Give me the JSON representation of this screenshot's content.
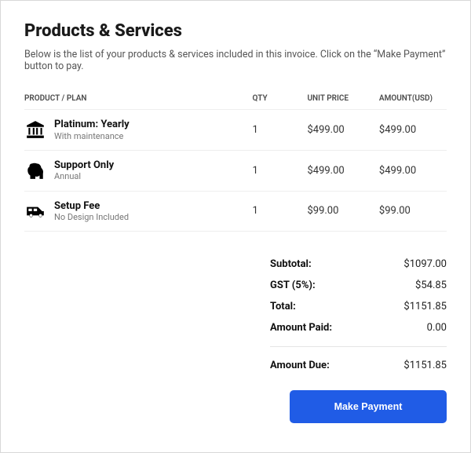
{
  "header": {
    "title": "Products & Services",
    "subtitle": "Below is the list of your products & services included in this invoice. Click on the “Make Payment” button to pay."
  },
  "table": {
    "columns": {
      "product": "PRODUCT / PLAN",
      "qty": "QTY",
      "unit_price": "UNIT PRICE",
      "amount": "AMOUNT(USD)"
    },
    "rows": [
      {
        "icon": "bank-icon",
        "name": "Platinum: Yearly",
        "desc": "With maintenance",
        "qty": "1",
        "unit_price": "$499.00",
        "amount": "$499.00"
      },
      {
        "icon": "gorilla-icon",
        "name": "Support Only",
        "desc": "Annual",
        "qty": "1",
        "unit_price": "$499.00",
        "amount": "$499.00"
      },
      {
        "icon": "van-icon",
        "name": "Setup Fee",
        "desc": "No Design Included",
        "qty": "1",
        "unit_price": "$99.00",
        "amount": "$99.00"
      }
    ]
  },
  "totals": {
    "subtotal_label": "Subtotal:",
    "subtotal_value": "$1097.00",
    "gst_label": "GST (5%):",
    "gst_value": "$54.85",
    "total_label": "Total:",
    "total_value": "$1151.85",
    "paid_label": "Amount Paid:",
    "paid_value": "0.00",
    "due_label": "Amount Due:",
    "due_value": "$1151.85"
  },
  "actions": {
    "make_payment": "Make Payment"
  }
}
